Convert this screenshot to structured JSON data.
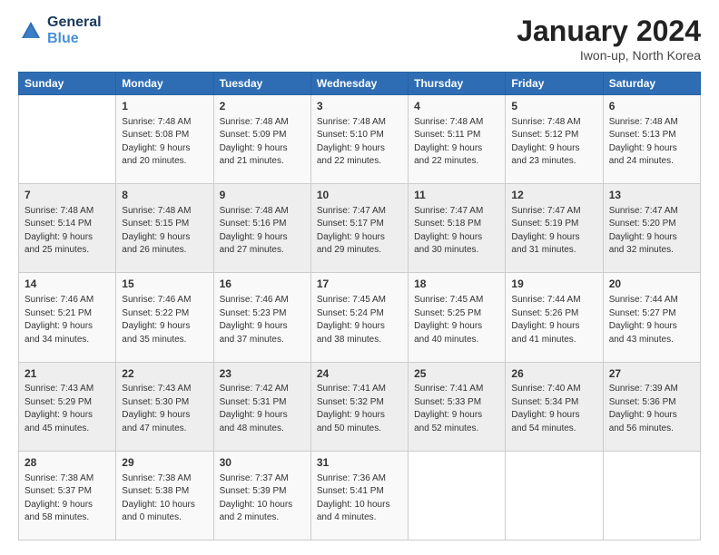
{
  "header": {
    "logo_line1": "General",
    "logo_line2": "Blue",
    "month": "January 2024",
    "location": "Iwon-up, North Korea"
  },
  "weekdays": [
    "Sunday",
    "Monday",
    "Tuesday",
    "Wednesday",
    "Thursday",
    "Friday",
    "Saturday"
  ],
  "weeks": [
    [
      {
        "day": "",
        "sunrise": "",
        "sunset": "",
        "daylight": ""
      },
      {
        "day": "1",
        "sunrise": "7:48 AM",
        "sunset": "5:08 PM",
        "daylight": "9 hours and 20 minutes."
      },
      {
        "day": "2",
        "sunrise": "7:48 AM",
        "sunset": "5:09 PM",
        "daylight": "9 hours and 21 minutes."
      },
      {
        "day": "3",
        "sunrise": "7:48 AM",
        "sunset": "5:10 PM",
        "daylight": "9 hours and 22 minutes."
      },
      {
        "day": "4",
        "sunrise": "7:48 AM",
        "sunset": "5:11 PM",
        "daylight": "9 hours and 22 minutes."
      },
      {
        "day": "5",
        "sunrise": "7:48 AM",
        "sunset": "5:12 PM",
        "daylight": "9 hours and 23 minutes."
      },
      {
        "day": "6",
        "sunrise": "7:48 AM",
        "sunset": "5:13 PM",
        "daylight": "9 hours and 24 minutes."
      }
    ],
    [
      {
        "day": "7",
        "sunrise": "7:48 AM",
        "sunset": "5:14 PM",
        "daylight": "9 hours and 25 minutes."
      },
      {
        "day": "8",
        "sunrise": "7:48 AM",
        "sunset": "5:15 PM",
        "daylight": "9 hours and 26 minutes."
      },
      {
        "day": "9",
        "sunrise": "7:48 AM",
        "sunset": "5:16 PM",
        "daylight": "9 hours and 27 minutes."
      },
      {
        "day": "10",
        "sunrise": "7:47 AM",
        "sunset": "5:17 PM",
        "daylight": "9 hours and 29 minutes."
      },
      {
        "day": "11",
        "sunrise": "7:47 AM",
        "sunset": "5:18 PM",
        "daylight": "9 hours and 30 minutes."
      },
      {
        "day": "12",
        "sunrise": "7:47 AM",
        "sunset": "5:19 PM",
        "daylight": "9 hours and 31 minutes."
      },
      {
        "day": "13",
        "sunrise": "7:47 AM",
        "sunset": "5:20 PM",
        "daylight": "9 hours and 32 minutes."
      }
    ],
    [
      {
        "day": "14",
        "sunrise": "7:46 AM",
        "sunset": "5:21 PM",
        "daylight": "9 hours and 34 minutes."
      },
      {
        "day": "15",
        "sunrise": "7:46 AM",
        "sunset": "5:22 PM",
        "daylight": "9 hours and 35 minutes."
      },
      {
        "day": "16",
        "sunrise": "7:46 AM",
        "sunset": "5:23 PM",
        "daylight": "9 hours and 37 minutes."
      },
      {
        "day": "17",
        "sunrise": "7:45 AM",
        "sunset": "5:24 PM",
        "daylight": "9 hours and 38 minutes."
      },
      {
        "day": "18",
        "sunrise": "7:45 AM",
        "sunset": "5:25 PM",
        "daylight": "9 hours and 40 minutes."
      },
      {
        "day": "19",
        "sunrise": "7:44 AM",
        "sunset": "5:26 PM",
        "daylight": "9 hours and 41 minutes."
      },
      {
        "day": "20",
        "sunrise": "7:44 AM",
        "sunset": "5:27 PM",
        "daylight": "9 hours and 43 minutes."
      }
    ],
    [
      {
        "day": "21",
        "sunrise": "7:43 AM",
        "sunset": "5:29 PM",
        "daylight": "9 hours and 45 minutes."
      },
      {
        "day": "22",
        "sunrise": "7:43 AM",
        "sunset": "5:30 PM",
        "daylight": "9 hours and 47 minutes."
      },
      {
        "day": "23",
        "sunrise": "7:42 AM",
        "sunset": "5:31 PM",
        "daylight": "9 hours and 48 minutes."
      },
      {
        "day": "24",
        "sunrise": "7:41 AM",
        "sunset": "5:32 PM",
        "daylight": "9 hours and 50 minutes."
      },
      {
        "day": "25",
        "sunrise": "7:41 AM",
        "sunset": "5:33 PM",
        "daylight": "9 hours and 52 minutes."
      },
      {
        "day": "26",
        "sunrise": "7:40 AM",
        "sunset": "5:34 PM",
        "daylight": "9 hours and 54 minutes."
      },
      {
        "day": "27",
        "sunrise": "7:39 AM",
        "sunset": "5:36 PM",
        "daylight": "9 hours and 56 minutes."
      }
    ],
    [
      {
        "day": "28",
        "sunrise": "7:38 AM",
        "sunset": "5:37 PM",
        "daylight": "9 hours and 58 minutes."
      },
      {
        "day": "29",
        "sunrise": "7:38 AM",
        "sunset": "5:38 PM",
        "daylight": "10 hours and 0 minutes."
      },
      {
        "day": "30",
        "sunrise": "7:37 AM",
        "sunset": "5:39 PM",
        "daylight": "10 hours and 2 minutes."
      },
      {
        "day": "31",
        "sunrise": "7:36 AM",
        "sunset": "5:41 PM",
        "daylight": "10 hours and 4 minutes."
      },
      {
        "day": "",
        "sunrise": "",
        "sunset": "",
        "daylight": ""
      },
      {
        "day": "",
        "sunrise": "",
        "sunset": "",
        "daylight": ""
      },
      {
        "day": "",
        "sunrise": "",
        "sunset": "",
        "daylight": ""
      }
    ]
  ]
}
